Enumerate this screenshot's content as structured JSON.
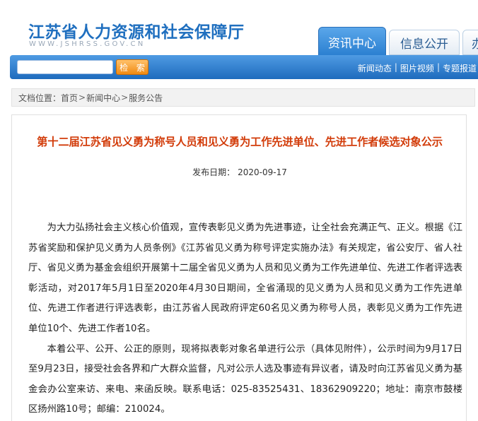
{
  "header": {
    "site_title": "江苏省人力资源和社会保障厅",
    "site_url": "WWW.JSHRSS.GOV.CN",
    "tabs": [
      {
        "label": "资讯中心",
        "active": true
      },
      {
        "label": "信息公开",
        "active": false
      },
      {
        "label": "办",
        "active": false
      }
    ]
  },
  "search": {
    "placeholder": "",
    "button_label": "检 索"
  },
  "subnav": {
    "items": [
      "新闻动态",
      "图片视频",
      "专题报道"
    ],
    "separator": "|"
  },
  "breadcrumb": {
    "prefix": "文档位置：",
    "items": [
      "首页",
      "新闻中心",
      "服务公告"
    ],
    "separator": ">"
  },
  "article": {
    "title": "第十二届江苏省见义勇为称号人员和见义勇为工作先进单位、先进工作者候选对象公示",
    "date_label": "发布日期：",
    "date": "2020-09-17",
    "paragraphs": [
      "为大力弘扬社会主义核心价值观，宣传表彰见义勇为先进事迹，让全社会充满正气、正义。根据《江苏省奖励和保护见义勇为人员条例》《江苏省见义勇为称号评定实施办法》有关规定，省公安厅、省人社厅、省见义勇为基金会组织开展第十二届全省见义勇为人员和见义勇为工作先进单位、先进工作者评选表彰活动，对2017年5月1日至2020年4月30日期间，全省涌现的见义勇为人员和见义勇为工作先进单位、先进工作者进行评选表彰，由江苏省人民政府评定60名见义勇为称号人员，表彰见义勇为工作先进单位10个、先进工作者10名。",
      "本着公平、公开、公正的原则，现将拟表彰对象名单进行公示（具体见附件），公示时间为9月17日至9月23日，接受社会各界和广大群众监督，凡对公示人选及事迹有异议者，请及时向江苏省见义勇为基金会办公室来访、来电、来函反映。联系电话：025-83525431、18362909220；地址：南京市鼓楼区扬州路10号；邮编：210024。"
    ]
  },
  "colors": {
    "brand_blue": "#1f6fbf",
    "nav_blue": "#2a7fd0",
    "title_red": "#d23c0a",
    "search_orange": "#f08a12"
  }
}
